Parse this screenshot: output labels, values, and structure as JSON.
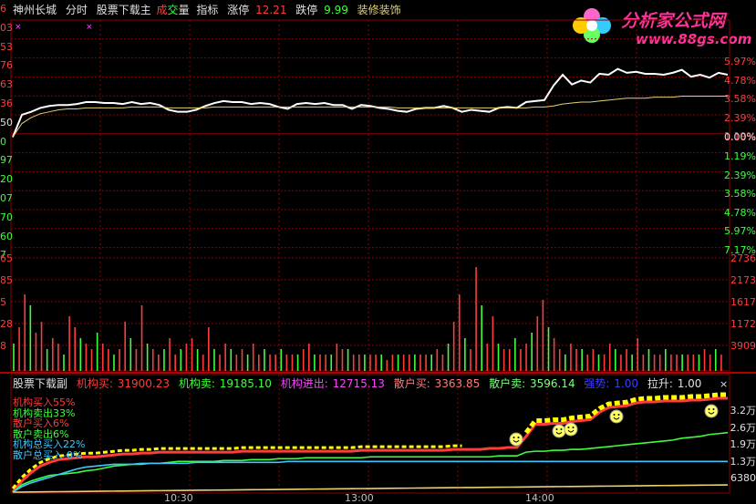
{
  "topbar": {
    "stock_name": "神州长城",
    "view_mode": "分时",
    "indicator_name": "股票下载主",
    "vol_label_a": "成",
    "vol_label_b": "交",
    "vol_label_c": "量",
    "indicator_menu": "指标",
    "limit_up_label": "涨停",
    "limit_up_value": "12.21",
    "limit_down_label": "跌停",
    "limit_down_value": "9.99",
    "decor_label": "装修装饰"
  },
  "logo": {
    "title": "分析家公式网",
    "url_text": "www.88gs.com"
  },
  "price_axis": {
    "left_labels": [
      "6",
      "03",
      "53",
      "76",
      "63",
      "36",
      "50",
      "0",
      "97",
      "20",
      "07",
      "70",
      "60",
      "7"
    ],
    "right_labels": [
      "5.97%",
      "4.78%",
      "3.58%",
      "2.39%",
      "1.19%",
      "0.00%",
      "1.19%",
      "2.39%",
      "3.58%",
      "4.78%",
      "5.97%",
      "7.17%"
    ],
    "pct_colors": {
      "up": "#ff3c3c",
      "zero": "#e0e0e0",
      "down": "#3cff3c"
    }
  },
  "volume_axis": {
    "left_labels": [
      "65",
      "85",
      "5",
      "28",
      "8"
    ],
    "right_labels": [
      "2736",
      "2173",
      "1617",
      "1172",
      "3909"
    ]
  },
  "sub_header": {
    "title": "股票下载副",
    "inst_buy_label": "机构买:",
    "inst_buy_value": "31900.23",
    "inst_sell_label": "机构卖:",
    "inst_sell_value": "19185.10",
    "inst_net_label": "机构进出:",
    "inst_net_value": "12715.13",
    "retail_buy_label": "散户买:",
    "retail_buy_value": "3363.85",
    "retail_sell_label": "散户卖:",
    "retail_sell_value": "3596.14",
    "strength_label": "强势:",
    "strength_value": "1.00",
    "pull_label": "拉升:",
    "pull_value": "1.00"
  },
  "legend": {
    "items": [
      {
        "text": "机构买入55%",
        "color": "#ff3c3c"
      },
      {
        "text": "机构卖出33%",
        "color": "#3cff3c"
      },
      {
        "text": "散户买入6%",
        "color": "#ff3c3c"
      },
      {
        "text": "散户卖出6%",
        "color": "#3cff3c"
      },
      {
        "text": "机构总买入22%",
        "color": "#3cc8ff"
      },
      {
        "text": "散户总买入-0%",
        "color": "#3cc8ff"
      }
    ]
  },
  "sub_axis": {
    "right_labels": [
      "3.2万",
      "2.6万",
      "1.9万",
      "1.3万",
      "6380"
    ]
  },
  "x_axis": {
    "labels": [
      "10:30",
      "13:00",
      "14:00"
    ]
  },
  "chart_data": [
    {
      "type": "line",
      "title": "",
      "series": [
        {
          "color": "#ffffff",
          "values": [
            0.0,
            2.3,
            2.6,
            3.0,
            3.2,
            3.3,
            3.3,
            3.4,
            3.6,
            3.6,
            3.5,
            3.5,
            3.4,
            3.6,
            3.4,
            3.5,
            3.3,
            2.8,
            2.6,
            2.6,
            2.8,
            3.2,
            3.5,
            3.7,
            3.6,
            3.6,
            3.4,
            3.5,
            3.4,
            3.1,
            2.9,
            3.4,
            3.5,
            3.4,
            3.5,
            3.3,
            3.3,
            2.9,
            3.3,
            3.2,
            3.0,
            2.9,
            2.7,
            2.6,
            2.9,
            3.0,
            3.0,
            3.2,
            3.0,
            2.6,
            2.8,
            2.7,
            2.6,
            3.0,
            3.1,
            3.0,
            3.6,
            3.7,
            3.8,
            5.3,
            6.4,
            5.4,
            5.8,
            5.6,
            6.5,
            6.4,
            7.0,
            6.6,
            6.7,
            6.5,
            6.5,
            6.4,
            6.6,
            6.9,
            6.2,
            6.4,
            6.1,
            6.6,
            6.4
          ]
        },
        {
          "color": "#e6d26e",
          "values": [
            0.0,
            1.4,
            2.0,
            2.4,
            2.6,
            2.8,
            2.9,
            2.9,
            3.0,
            3.0,
            3.0,
            3.0,
            3.0,
            3.1,
            3.1,
            3.1,
            3.1,
            3.0,
            3.0,
            3.0,
            3.0,
            3.0,
            3.1,
            3.1,
            3.1,
            3.1,
            3.1,
            3.1,
            3.1,
            3.1,
            3.1,
            3.1,
            3.1,
            3.1,
            3.1,
            3.1,
            3.1,
            3.1,
            3.1,
            3.1,
            3.1,
            3.1,
            3.0,
            3.0,
            3.0,
            3.0,
            3.0,
            3.0,
            3.0,
            3.0,
            3.0,
            3.0,
            3.0,
            3.0,
            3.0,
            3.0,
            3.0,
            3.1,
            3.1,
            3.2,
            3.4,
            3.5,
            3.6,
            3.6,
            3.7,
            3.8,
            3.9,
            4.0,
            4.0,
            4.0,
            4.1,
            4.1,
            4.1,
            4.2,
            4.2,
            4.2,
            4.2,
            4.2,
            4.2
          ]
        }
      ]
    },
    {
      "type": "bar",
      "title": "",
      "values": [
        5,
        8,
        14,
        12,
        7,
        9,
        4,
        6,
        5,
        3,
        10,
        8,
        6,
        5,
        4,
        7,
        5,
        4,
        3,
        4,
        9,
        6,
        4,
        12,
        5,
        4,
        3,
        4,
        6,
        3,
        4,
        5,
        6,
        4,
        3,
        8,
        4,
        3,
        5,
        4,
        3,
        4,
        3,
        5,
        3,
        4,
        3,
        3,
        4,
        3,
        3,
        3,
        4,
        5,
        3,
        3,
        3,
        3,
        5,
        4,
        4,
        3,
        3,
        3,
        3,
        3,
        3,
        2,
        3,
        3,
        3,
        3,
        3,
        3,
        3,
        3,
        4,
        3,
        5,
        9,
        14,
        6,
        4,
        19,
        12,
        5,
        10,
        5,
        4,
        4,
        6,
        4,
        5,
        7,
        10,
        13,
        8,
        6,
        4,
        3,
        5,
        4,
        4,
        3,
        4,
        3,
        3,
        5,
        4,
        3,
        4,
        3,
        6,
        3,
        4,
        3,
        3,
        4,
        3,
        3,
        3,
        3,
        3,
        3,
        4,
        3,
        4,
        3
      ],
      "colors_pattern": "red-green alternating by tick"
    },
    {
      "type": "line",
      "title": "",
      "series": [
        {
          "color": "#ff3c3c",
          "values": [
            0.0,
            1.2,
            2.1,
            2.8,
            3.2,
            3.5,
            3.6,
            3.7,
            3.8,
            3.8,
            3.9,
            4.0,
            4.1,
            4.1,
            4.2,
            4.2,
            4.3,
            4.3,
            4.3,
            4.3,
            4.3,
            4.3,
            4.3,
            4.3,
            4.3,
            4.4,
            4.4,
            4.4,
            4.4,
            4.4,
            4.4,
            4.4,
            4.4,
            4.4,
            4.4,
            4.4,
            4.4,
            4.4,
            4.5,
            4.5,
            4.5,
            4.5,
            4.5,
            4.5,
            4.5,
            4.5,
            4.5,
            4.5,
            4.6,
            4.6,
            4.6,
            4.6,
            4.7,
            4.7,
            4.8,
            4.8,
            6.0,
            7.3,
            7.3,
            7.4,
            7.4,
            7.6,
            7.7,
            7.8,
            8.6,
            9.1,
            9.2,
            9.3,
            9.6,
            9.7,
            9.7,
            9.8,
            9.8,
            9.8,
            9.9,
            9.9,
            10.0,
            10.1,
            10.1
          ]
        },
        {
          "color": "#3cff3c",
          "values": [
            0.0,
            0.8,
            1.2,
            1.5,
            1.8,
            1.9,
            2.0,
            2.1,
            2.3,
            2.4,
            2.6,
            2.8,
            2.9,
            3.0,
            3.0,
            3.1,
            3.1,
            3.2,
            3.3,
            3.3,
            3.3,
            3.3,
            3.3,
            3.4,
            3.4,
            3.4,
            3.5,
            3.5,
            3.5,
            3.6,
            3.6,
            3.6,
            3.7,
            3.7,
            3.7,
            3.7,
            3.7,
            3.7,
            3.7,
            3.8,
            3.8,
            3.8,
            3.8,
            3.8,
            3.8,
            3.8,
            3.8,
            3.8,
            3.8,
            3.8,
            3.8,
            3.8,
            3.8,
            3.9,
            3.9,
            3.9,
            4.3,
            4.4,
            4.4,
            4.5,
            4.5,
            4.6,
            4.6,
            4.7,
            4.8,
            4.9,
            5.0,
            5.1,
            5.2,
            5.3,
            5.4,
            5.5,
            5.6,
            5.8,
            5.9,
            6.0,
            6.2,
            6.3,
            6.4
          ]
        },
        {
          "color": "#3cc8ff",
          "values": [
            0.0,
            0.6,
            1.0,
            1.3,
            1.6,
            1.9,
            2.2,
            2.5,
            2.7,
            2.8,
            2.9,
            3.0,
            3.0,
            3.0,
            3.1,
            3.1,
            3.1,
            3.1,
            3.1,
            3.1,
            3.2,
            3.2,
            3.2,
            3.2,
            3.2,
            3.2,
            3.2,
            3.2,
            3.2,
            3.2,
            3.3,
            3.3,
            3.3,
            3.3,
            3.3,
            3.3,
            3.3,
            3.3,
            3.3,
            3.3,
            3.3,
            3.3,
            3.3,
            3.3,
            3.3,
            3.3,
            3.3,
            3.3,
            3.3,
            3.3,
            3.3,
            3.3,
            3.3,
            3.3,
            3.3,
            3.3,
            3.3,
            3.3,
            3.3,
            3.3,
            3.3,
            3.3,
            3.3,
            3.3,
            3.3,
            3.3,
            3.3,
            3.3,
            3.3,
            3.3,
            3.3,
            3.3,
            3.3,
            3.3,
            3.3,
            3.3,
            3.3,
            3.3,
            3.3
          ]
        },
        {
          "color": "#e6d26e",
          "values": [
            0.0,
            0.01,
            0.02,
            0.03,
            0.04,
            0.05,
            0.06,
            0.07,
            0.08,
            0.09,
            0.1,
            0.11,
            0.12,
            0.13,
            0.14,
            0.15,
            0.16,
            0.17,
            0.18,
            0.19,
            0.2,
            0.21,
            0.22,
            0.23,
            0.24,
            0.25,
            0.26,
            0.27,
            0.28,
            0.29,
            0.3,
            0.31,
            0.32,
            0.33,
            0.34,
            0.35,
            0.36,
            0.37,
            0.38,
            0.39,
            0.4,
            0.41,
            0.42,
            0.43,
            0.44,
            0.45,
            0.46,
            0.47,
            0.48,
            0.49,
            0.5,
            0.51,
            0.52,
            0.53,
            0.54,
            0.55,
            0.56,
            0.57,
            0.58,
            0.59,
            0.6,
            0.61,
            0.62,
            0.63,
            0.64,
            0.65,
            0.66,
            0.67,
            0.68,
            0.69,
            0.7,
            0.71,
            0.72,
            0.73,
            0.74,
            0.75,
            0.76,
            0.77,
            0.78
          ]
        }
      ]
    }
  ]
}
